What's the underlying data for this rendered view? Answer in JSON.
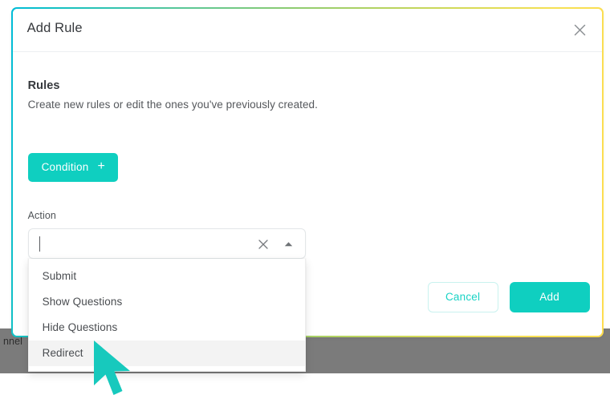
{
  "backdrop": {
    "partial_text": "nnel",
    "band_color": "#7b7b7b"
  },
  "modal": {
    "title": "Add Rule",
    "close_icon": "close-icon",
    "border_gradient": [
      "#00bcd8",
      "#8dcc72",
      "#ffdd4f"
    ],
    "section": {
      "heading": "Rules",
      "subheading": "Create new rules or edit the ones you've previously created."
    },
    "condition_button": {
      "label": "Condition",
      "plus_glyph": "+",
      "color": "#0fcfc0"
    },
    "action_field": {
      "label": "Action",
      "value": "",
      "placeholder": "",
      "clear_icon": "close-icon",
      "toggle_icon": "chevron-up-icon",
      "expanded": true,
      "options": [
        {
          "label": "Submit",
          "highlighted": false
        },
        {
          "label": "Show Questions",
          "highlighted": false
        },
        {
          "label": "Hide Questions",
          "highlighted": false
        },
        {
          "label": "Redirect",
          "highlighted": true
        }
      ]
    },
    "footer": {
      "cancel_label": "Cancel",
      "add_label": "Add",
      "accent_color": "#0fcfc0"
    }
  },
  "cursor": {
    "icon": "arrow-pointer-cursor",
    "color": "#17c9bd"
  }
}
